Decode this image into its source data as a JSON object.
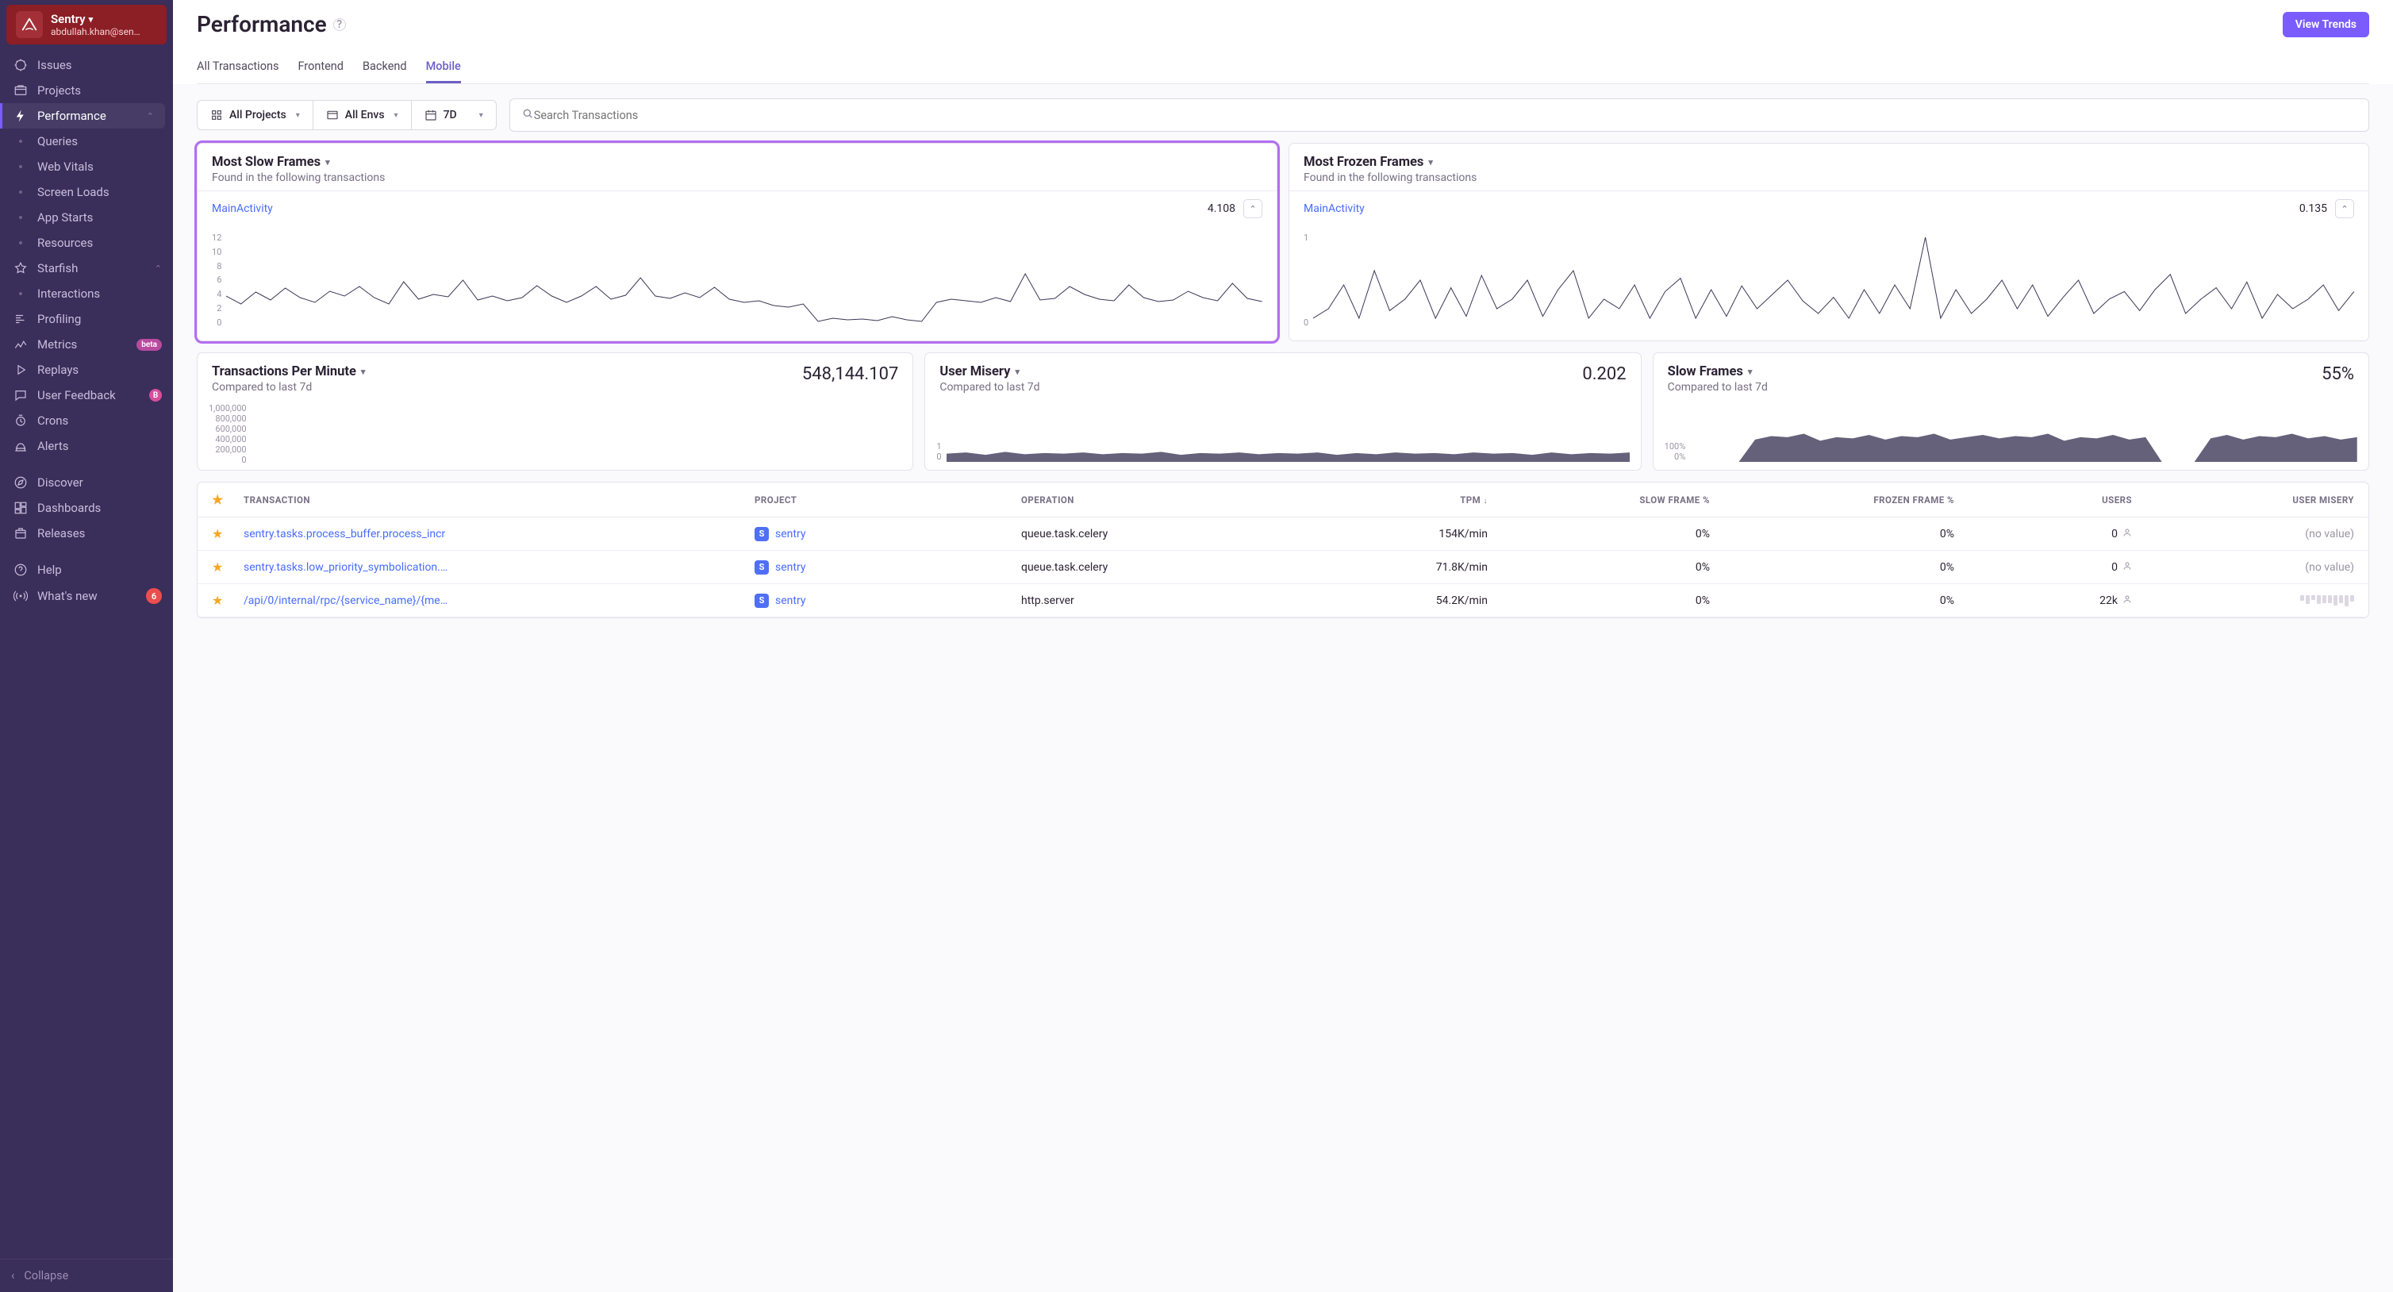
{
  "org": {
    "name": "Sentry",
    "email": "abdullah.khan@sen…"
  },
  "sidebar": {
    "items": [
      {
        "label": "Issues",
        "icon": "issues"
      },
      {
        "label": "Projects",
        "icon": "projects"
      },
      {
        "label": "Performance",
        "icon": "bolt",
        "active": true,
        "expandable": true
      },
      {
        "label": "Queries",
        "sub": true
      },
      {
        "label": "Web Vitals",
        "sub": true
      },
      {
        "label": "Screen Loads",
        "sub": true
      },
      {
        "label": "App Starts",
        "sub": true
      },
      {
        "label": "Resources",
        "sub": true
      },
      {
        "label": "Starfish",
        "icon": "star",
        "expandable": true
      },
      {
        "label": "Interactions",
        "sub": true
      },
      {
        "label": "Profiling",
        "icon": "profiling"
      },
      {
        "label": "Metrics",
        "icon": "metrics",
        "badge_beta": "beta"
      },
      {
        "label": "Replays",
        "icon": "replay"
      },
      {
        "label": "User Feedback",
        "icon": "feedback",
        "badge_pink": "B"
      },
      {
        "label": "Crons",
        "icon": "crons"
      },
      {
        "label": "Alerts",
        "icon": "alerts"
      },
      {
        "label": "",
        "gap": true
      },
      {
        "label": "Discover",
        "icon": "discover"
      },
      {
        "label": "Dashboards",
        "icon": "dashboards"
      },
      {
        "label": "Releases",
        "icon": "releases"
      },
      {
        "label": "",
        "gap": true
      },
      {
        "label": "Help",
        "icon": "help"
      },
      {
        "label": "What's new",
        "icon": "broadcast",
        "badge_red": "6"
      }
    ],
    "collapse": "Collapse"
  },
  "page": {
    "title": "Performance",
    "view_trends": "View Trends",
    "tabs": [
      "All Transactions",
      "Frontend",
      "Backend",
      "Mobile"
    ],
    "active_tab": 3,
    "filters": {
      "projects": "All Projects",
      "envs": "All Envs",
      "period": "7D"
    },
    "search_placeholder": "Search Transactions"
  },
  "cards": {
    "slow_frames": {
      "title": "Most Slow Frames",
      "sub": "Found in the following transactions",
      "txn": "MainActivity",
      "value": "4.108"
    },
    "frozen_frames": {
      "title": "Most Frozen Frames",
      "sub": "Found in the following transactions",
      "txn": "MainActivity",
      "value": "0.135"
    },
    "tpm": {
      "title": "Transactions Per Minute",
      "sub": "Compared to last 7d",
      "value": "548,144.107"
    },
    "misery": {
      "title": "User Misery",
      "sub": "Compared to last 7d",
      "value": "0.202"
    },
    "sframes": {
      "title": "Slow Frames",
      "sub": "Compared to last 7d",
      "value": "55%"
    }
  },
  "table": {
    "columns": [
      "TRANSACTION",
      "PROJECT",
      "OPERATION",
      "TPM",
      "SLOW FRAME %",
      "FROZEN FRAME %",
      "USERS",
      "USER MISERY"
    ],
    "rows": [
      {
        "txn": "sentry.tasks.process_buffer.process_incr",
        "project": "sentry",
        "op": "queue.task.celery",
        "tpm": "154K/min",
        "slow": "0%",
        "frozen": "0%",
        "users": "0",
        "misery": "(no value)"
      },
      {
        "txn": "sentry.tasks.low_priority_symbolication.…",
        "project": "sentry",
        "op": "queue.task.celery",
        "tpm": "71.8K/min",
        "slow": "0%",
        "frozen": "0%",
        "users": "0",
        "misery": "(no value)"
      },
      {
        "txn": "/api/0/internal/rpc/{service_name}/{me…",
        "project": "sentry",
        "op": "http.server",
        "tpm": "54.2K/min",
        "slow": "0%",
        "frozen": "0%",
        "users": "22k",
        "misery": "bars"
      }
    ]
  },
  "chart_data": [
    {
      "id": "most-slow-frames",
      "type": "line",
      "ylabel": "",
      "ylim": [
        0,
        12
      ],
      "yticks": [
        12,
        10,
        8,
        6,
        4,
        2,
        0
      ],
      "values": [
        4,
        3,
        4.5,
        3.5,
        5,
        3.8,
        3.2,
        4.6,
        4,
        5.2,
        3.8,
        3,
        5.8,
        3.6,
        4.2,
        3.9,
        6,
        3.5,
        4,
        3.4,
        3.8,
        5.3,
        4,
        3.2,
        4,
        5.2,
        3.6,
        4.1,
        6.3,
        4,
        3.7,
        4.4,
        3.8,
        5.1,
        3.6,
        3.2,
        3.4,
        2.8,
        2.6,
        3,
        0.8,
        1.2,
        1,
        1.1,
        0.9,
        1.4,
        1,
        0.8,
        3.2,
        3.6,
        3.4,
        3.2,
        3.8,
        3.3,
        6.8,
        3.5,
        3.7,
        5.2,
        4.2,
        3.6,
        3.4,
        5.4,
        3.8,
        3.3,
        3.5,
        4.6,
        3.8,
        3.4,
        5.6,
        3.7,
        3.3
      ]
    },
    {
      "id": "most-frozen-frames",
      "type": "line",
      "ylim": [
        0,
        1
      ],
      "yticks": [
        1,
        0
      ],
      "values": [
        0.1,
        0.2,
        0.45,
        0.1,
        0.6,
        0.18,
        0.3,
        0.5,
        0.1,
        0.42,
        0.12,
        0.55,
        0.2,
        0.3,
        0.5,
        0.12,
        0.4,
        0.6,
        0.1,
        0.3,
        0.2,
        0.45,
        0.1,
        0.38,
        0.52,
        0.1,
        0.4,
        0.12,
        0.44,
        0.2,
        0.35,
        0.5,
        0.28,
        0.15,
        0.32,
        0.1,
        0.4,
        0.15,
        0.45,
        0.2,
        0.95,
        0.1,
        0.4,
        0.15,
        0.3,
        0.5,
        0.2,
        0.45,
        0.12,
        0.32,
        0.5,
        0.15,
        0.3,
        0.38,
        0.18,
        0.4,
        0.56,
        0.15,
        0.3,
        0.42,
        0.2,
        0.48,
        0.1,
        0.35,
        0.2,
        0.3,
        0.45,
        0.18,
        0.38
      ]
    },
    {
      "id": "tpm",
      "type": "area",
      "ylim": [
        0,
        1000000
      ],
      "yticks": [
        "1,000,000",
        "800,000",
        "600,000",
        "400,000",
        "200,000",
        "0"
      ],
      "color": "#7a5b9e",
      "values": [
        420,
        500,
        470,
        550,
        510,
        600,
        470,
        560,
        520,
        580,
        480,
        550,
        490,
        560,
        510,
        520,
        470,
        560,
        480,
        550,
        505,
        570,
        480,
        530,
        500,
        560,
        480,
        550,
        490,
        530,
        510,
        560,
        490,
        520,
        500,
        540,
        495,
        550,
        480,
        520
      ]
    },
    {
      "id": "user-misery",
      "type": "area",
      "ylim": [
        0,
        1
      ],
      "yticks": [
        "1",
        "0"
      ],
      "color": "#4a4563",
      "values": [
        0.14,
        0.16,
        0.12,
        0.17,
        0.13,
        0.15,
        0.14,
        0.16,
        0.13,
        0.15,
        0.14,
        0.17,
        0.12,
        0.15,
        0.14,
        0.16,
        0.13,
        0.15,
        0.14,
        0.16,
        0.12,
        0.15,
        0.13,
        0.16,
        0.14,
        0.15,
        0.13,
        0.16,
        0.14,
        0.15,
        0.12,
        0.16,
        0.13,
        0.15,
        0.14,
        0.16
      ]
    },
    {
      "id": "slow-frames-pct",
      "type": "area",
      "ylim": [
        0,
        100
      ],
      "yticks": [
        "100%",
        "0%"
      ],
      "color": "#4a4563",
      "values": [
        0,
        0,
        0,
        0,
        38,
        44,
        42,
        48,
        36,
        42,
        40,
        46,
        38,
        44,
        42,
        48,
        38,
        42,
        46,
        40,
        44,
        42,
        48,
        36,
        42,
        40,
        46,
        38,
        42,
        0,
        0,
        0,
        40,
        46,
        38,
        44,
        42,
        48,
        40,
        44,
        38,
        42
      ]
    }
  ]
}
